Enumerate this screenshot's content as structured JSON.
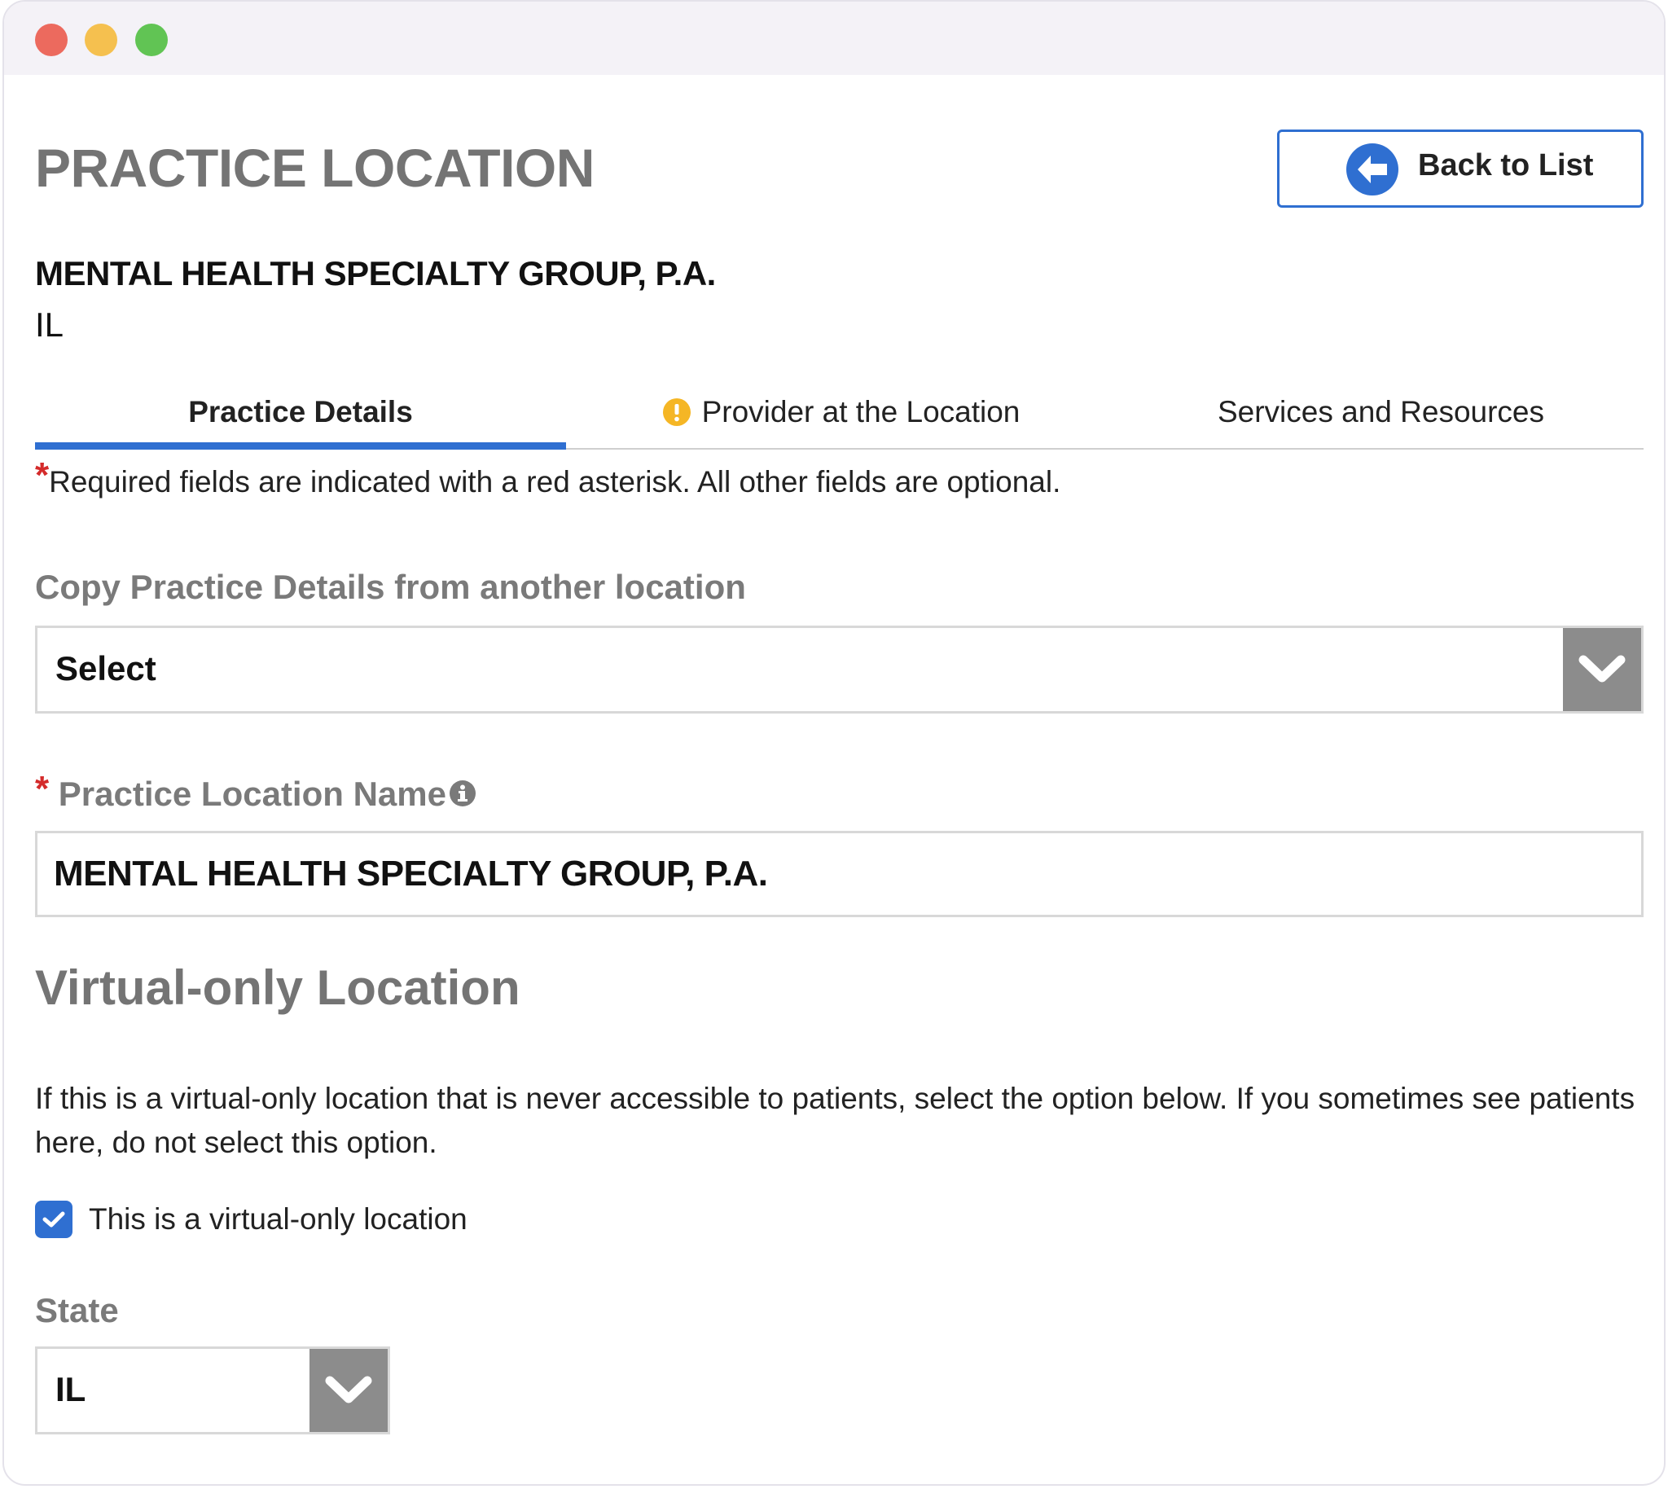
{
  "page": {
    "title": "PRACTICE LOCATION",
    "back_button_label": "Back to List"
  },
  "organization": {
    "name": "MENTAL HEALTH SPECIALTY GROUP, P.A.",
    "state": "IL"
  },
  "tabs": [
    {
      "label": "Practice Details",
      "active": true
    },
    {
      "label": "Provider at the Location",
      "icon": "warning-icon"
    },
    {
      "label": "Services and Resources"
    }
  ],
  "required_note": {
    "asterisk": "*",
    "text": "Required fields are indicated with a red asterisk. All other fields are optional."
  },
  "copy_details": {
    "label": "Copy Practice Details from another location",
    "selected": "Select"
  },
  "location_name": {
    "asterisk": "*",
    "label": "Practice Location Name",
    "value": "MENTAL HEALTH SPECIALTY GROUP, P.A."
  },
  "virtual": {
    "title": "Virtual-only Location",
    "description": "If this is a virtual-only location that is never accessible to patients, select the option below. If you sometimes see patients here, do not select this option.",
    "checkbox_label": "This is a virtual-only location",
    "checked": true
  },
  "state_field": {
    "label": "State",
    "selected": "IL"
  },
  "colors": {
    "accent": "#2f6fd1",
    "required": "#d42b2b",
    "warning": "#f5b625",
    "arrow_bg": "#8c8c8c"
  }
}
